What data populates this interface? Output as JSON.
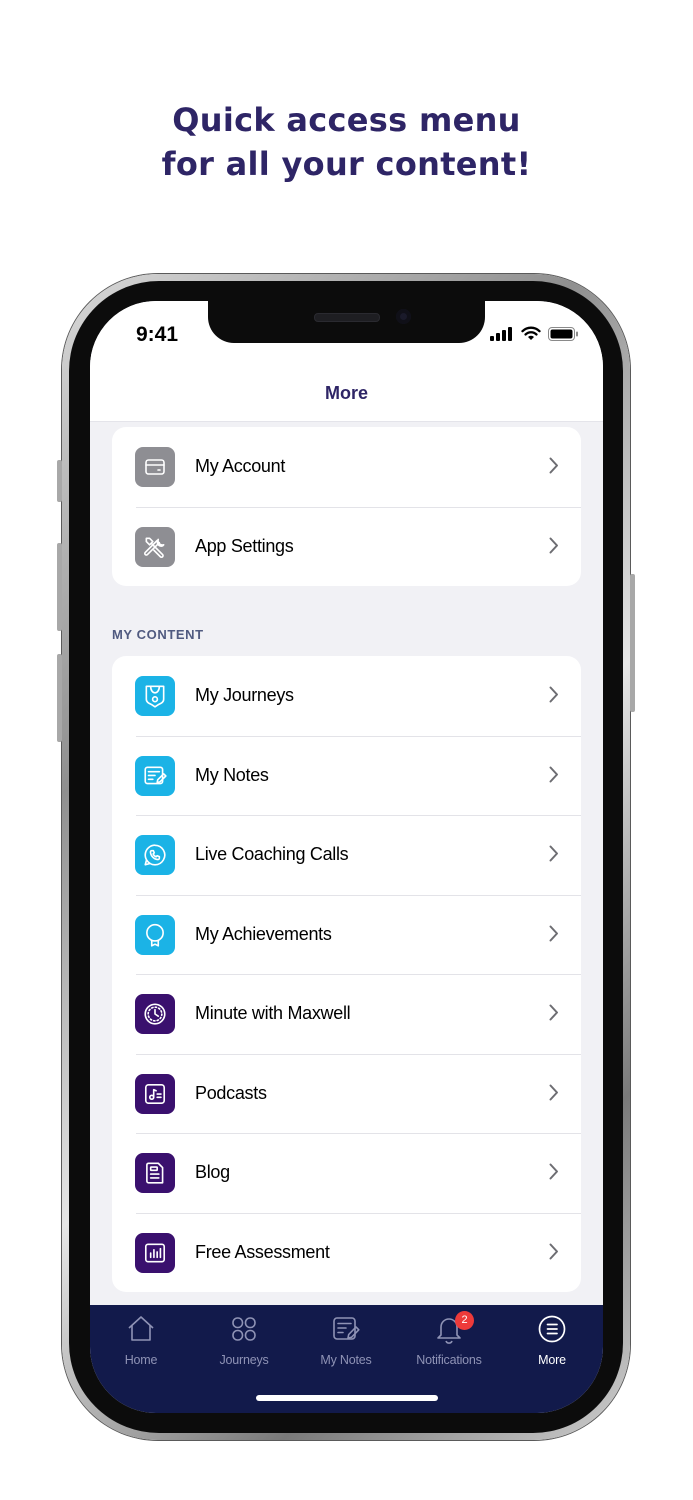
{
  "headline": {
    "line1": "Quick access menu",
    "line2": "for all your content!"
  },
  "status_bar": {
    "time": "9:41"
  },
  "nav": {
    "title": "More"
  },
  "account_section": {
    "items": [
      {
        "label": "My Account",
        "icon": "credit-card-icon",
        "color": "#8e8e93"
      },
      {
        "label": "App Settings",
        "icon": "tools-icon",
        "color": "#8e8e93"
      }
    ]
  },
  "content_section": {
    "header": "MY CONTENT",
    "items": [
      {
        "label": "My Journeys",
        "icon": "journey-shield-icon",
        "color": "#1bb3e6"
      },
      {
        "label": "My Notes",
        "icon": "notes-icon",
        "color": "#1bb3e6"
      },
      {
        "label": "Live Coaching Calls",
        "icon": "phone-call-icon",
        "color": "#1bb3e6"
      },
      {
        "label": "My Achievements",
        "icon": "award-ribbon-icon",
        "color": "#1bb3e6"
      },
      {
        "label": "Minute with Maxwell",
        "icon": "clock-icon",
        "color": "#3a106e"
      },
      {
        "label": "Podcasts",
        "icon": "music-list-icon",
        "color": "#3a106e"
      },
      {
        "label": "Blog",
        "icon": "document-icon",
        "color": "#3a106e"
      },
      {
        "label": "Free Assessment",
        "icon": "bar-chart-icon",
        "color": "#3a106e"
      }
    ]
  },
  "tab_bar": {
    "tabs": [
      {
        "label": "Home",
        "icon": "home-icon",
        "active": false
      },
      {
        "label": "Journeys",
        "icon": "grid-icon",
        "active": false
      },
      {
        "label": "My Notes",
        "icon": "notes-icon",
        "active": false
      },
      {
        "label": "Notifications",
        "icon": "bell-icon",
        "active": false,
        "badge": "2"
      },
      {
        "label": "More",
        "icon": "menu-list-icon",
        "active": true
      }
    ]
  },
  "colors": {
    "brand": "#2e2566",
    "tab_bar": "#121a4b",
    "cyan": "#1bb3e6",
    "purple": "#3a106e",
    "badge": "#ee3a3a"
  }
}
